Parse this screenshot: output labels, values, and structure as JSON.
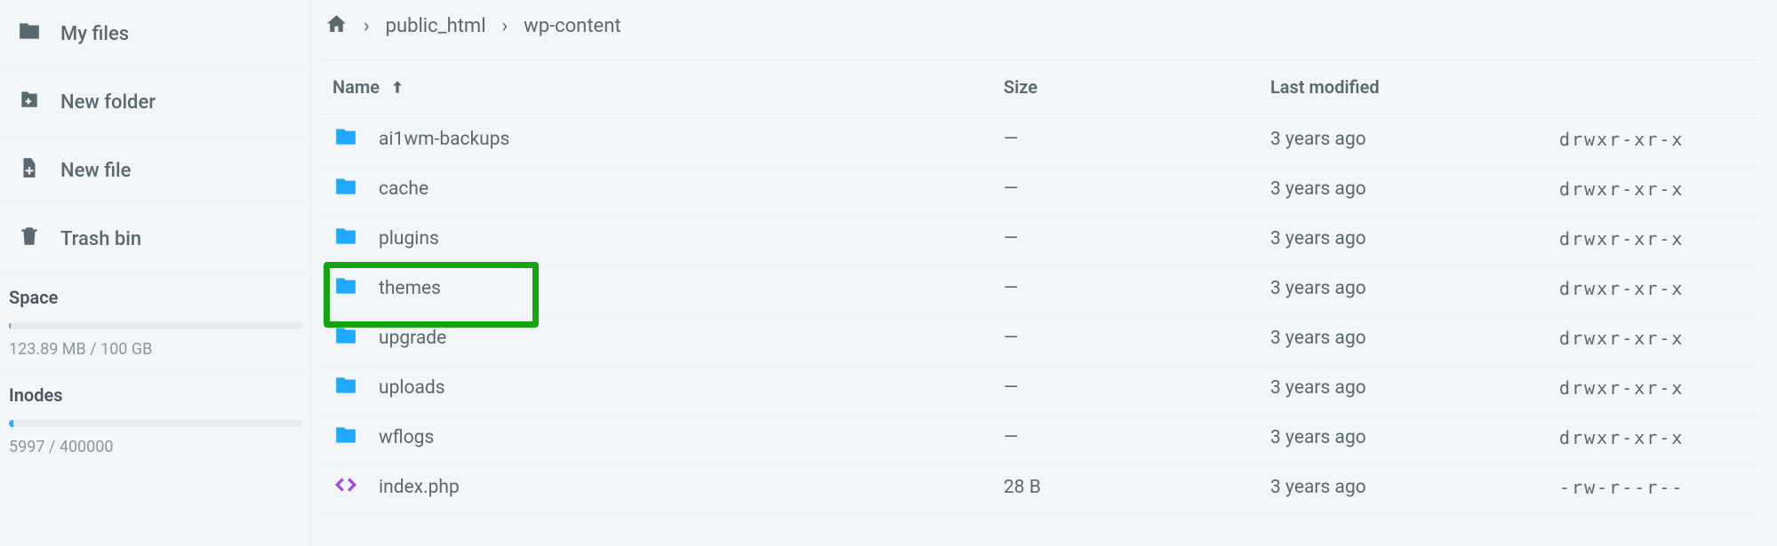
{
  "sidebar": {
    "items": [
      {
        "label": "My files"
      },
      {
        "label": "New folder"
      },
      {
        "label": "New file"
      },
      {
        "label": "Trash bin"
      }
    ],
    "space": {
      "title": "Space",
      "usage_text": "123.89 MB / 100 GB",
      "fill_pct": 0.5
    },
    "inodes": {
      "title": "Inodes",
      "usage_text": "5997 / 400000",
      "fill_pct": 1.5
    }
  },
  "breadcrumb": {
    "parts": [
      "public_html",
      "wp-content"
    ]
  },
  "columns": {
    "name": "Name",
    "size": "Size",
    "modified": "Last modified"
  },
  "rows": [
    {
      "name": "ai1wm-backups",
      "type": "folder",
      "size": "—",
      "modified": "3 years ago",
      "perms": "drwxr-xr-x",
      "highlight": false
    },
    {
      "name": "cache",
      "type": "folder",
      "size": "—",
      "modified": "3 years ago",
      "perms": "drwxr-xr-x",
      "highlight": false
    },
    {
      "name": "plugins",
      "type": "folder",
      "size": "—",
      "modified": "3 years ago",
      "perms": "drwxr-xr-x",
      "highlight": false
    },
    {
      "name": "themes",
      "type": "folder",
      "size": "—",
      "modified": "3 years ago",
      "perms": "drwxr-xr-x",
      "highlight": true
    },
    {
      "name": "upgrade",
      "type": "folder",
      "size": "—",
      "modified": "3 years ago",
      "perms": "drwxr-xr-x",
      "highlight": false
    },
    {
      "name": "uploads",
      "type": "folder",
      "size": "—",
      "modified": "3 years ago",
      "perms": "drwxr-xr-x",
      "highlight": false
    },
    {
      "name": "wflogs",
      "type": "folder",
      "size": "—",
      "modified": "3 years ago",
      "perms": "drwxr-xr-x",
      "highlight": false
    },
    {
      "name": "index.php",
      "type": "code",
      "size": "28 B",
      "modified": "3 years ago",
      "perms": "-rw-r--r--",
      "highlight": false
    }
  ]
}
